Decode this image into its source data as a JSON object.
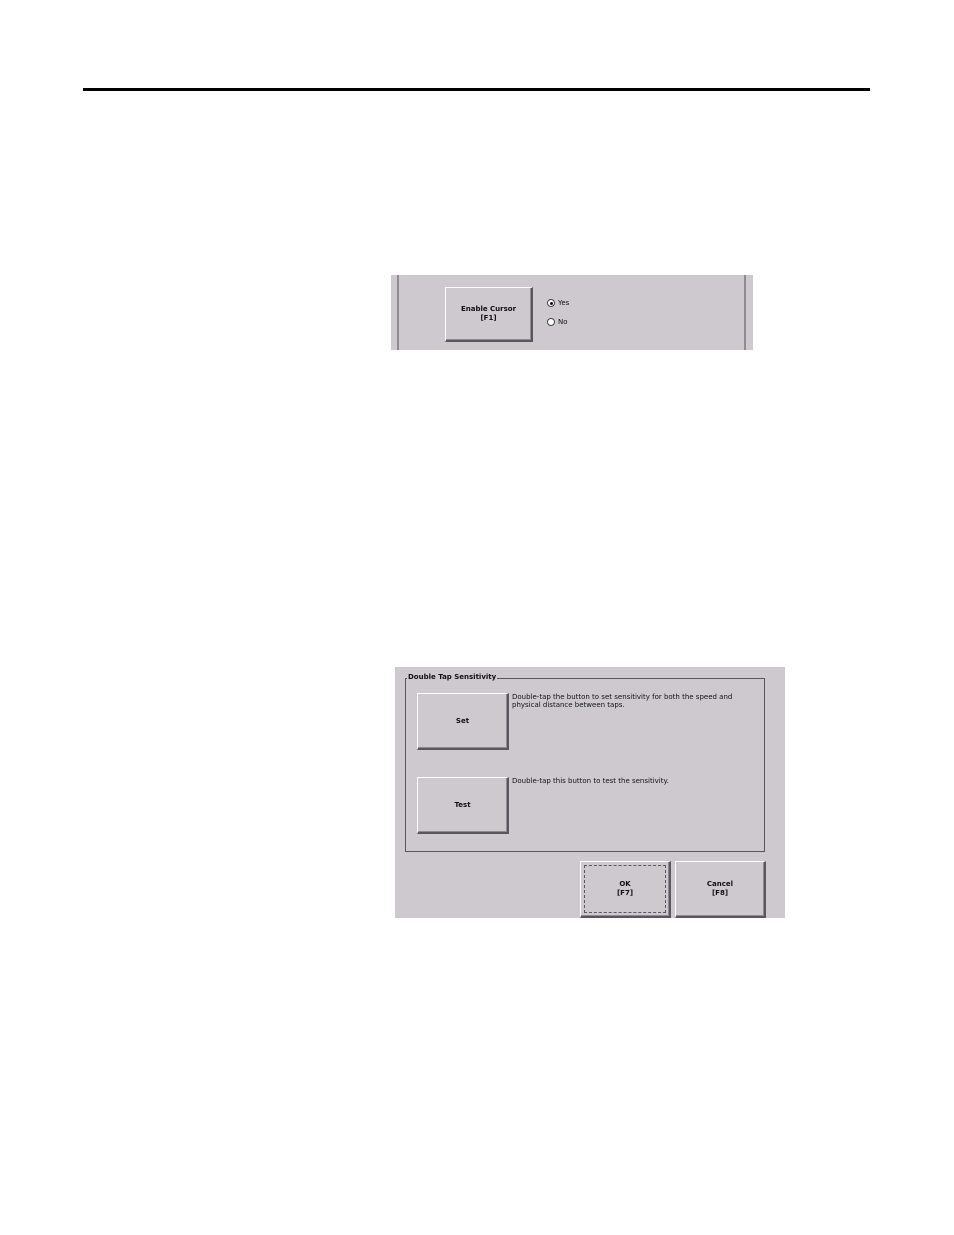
{
  "cursor_panel": {
    "enable_button": {
      "line1": "Enable Cursor",
      "line2": "[F1]"
    },
    "radio_options": [
      {
        "label": "Yes",
        "selected": true
      },
      {
        "label": "No",
        "selected": false
      }
    ]
  },
  "double_tap_panel": {
    "group_title": "Double Tap Sensitivity",
    "set_button": {
      "label": "Set"
    },
    "set_description": "Double-tap the button to set sensitivity for both the speed and physical distance between taps.",
    "test_button": {
      "label": "Test"
    },
    "test_description": "Double-tap this button to test the sensitivity.",
    "ok_button": {
      "line1": "OK",
      "line2": "[F7]"
    },
    "cancel_button": {
      "line1": "Cancel",
      "line2": "[F8]"
    }
  },
  "colors": {
    "panel_bg": "#cdc9cf",
    "border_dark": "#5a5660",
    "rule": "#000000"
  }
}
